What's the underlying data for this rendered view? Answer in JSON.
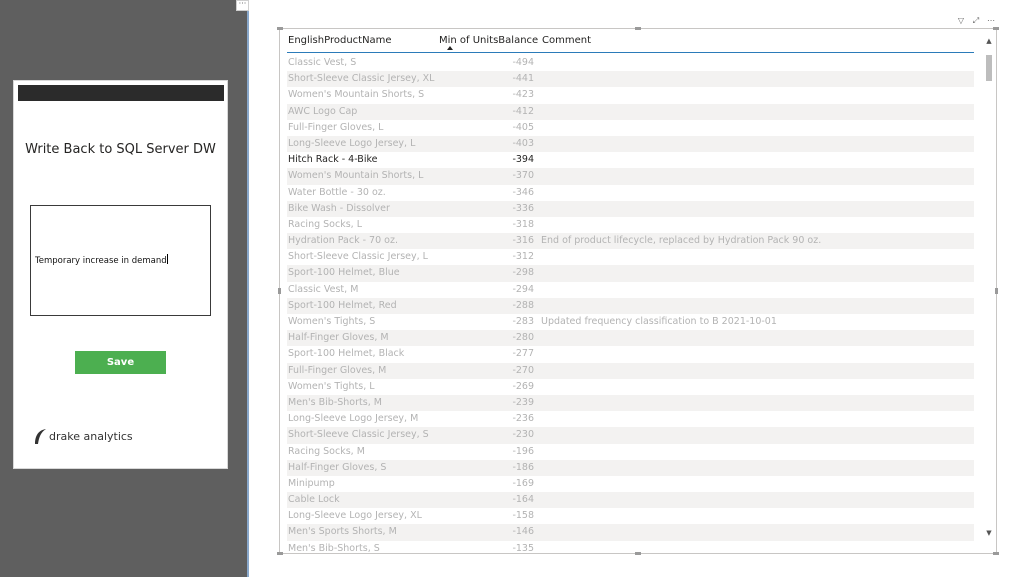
{
  "app": {
    "title": "Write Back to SQL Server DW",
    "comment_value": "Temporary increase in demand",
    "save_label": "Save",
    "logo_text": "drake analytics"
  },
  "more_label": "···",
  "visual_icons": [
    "filter-icon",
    "focus-mode-icon",
    "more-options-icon"
  ],
  "table": {
    "columns": [
      "EnglishProductName",
      "Min of UnitsBalance",
      "Comment"
    ],
    "sorted_column": "Min of UnitsBalance",
    "sort_direction": "ascending",
    "highlighted_row": "Hitch Rack - 4-Bike",
    "rows": [
      {
        "name": "Classic Vest, S",
        "value": "-494",
        "comment": ""
      },
      {
        "name": "Short-Sleeve Classic Jersey, XL",
        "value": "-441",
        "comment": ""
      },
      {
        "name": "Women's Mountain Shorts, S",
        "value": "-423",
        "comment": ""
      },
      {
        "name": "AWC Logo Cap",
        "value": "-412",
        "comment": ""
      },
      {
        "name": "Full-Finger Gloves, L",
        "value": "-405",
        "comment": ""
      },
      {
        "name": "Long-Sleeve Logo Jersey, L",
        "value": "-403",
        "comment": ""
      },
      {
        "name": "Hitch Rack - 4-Bike",
        "value": "-394",
        "comment": ""
      },
      {
        "name": "Women's Mountain Shorts, L",
        "value": "-370",
        "comment": ""
      },
      {
        "name": "Water Bottle - 30 oz.",
        "value": "-346",
        "comment": ""
      },
      {
        "name": "Bike Wash - Dissolver",
        "value": "-336",
        "comment": ""
      },
      {
        "name": "Racing Socks, L",
        "value": "-318",
        "comment": ""
      },
      {
        "name": "Hydration Pack - 70 oz.",
        "value": "-316",
        "comment": "End of product lifecycle, replaced by Hydration Pack 90 oz."
      },
      {
        "name": "Short-Sleeve Classic Jersey, L",
        "value": "-312",
        "comment": ""
      },
      {
        "name": "Sport-100 Helmet, Blue",
        "value": "-298",
        "comment": ""
      },
      {
        "name": "Classic Vest, M",
        "value": "-294",
        "comment": ""
      },
      {
        "name": "Sport-100 Helmet, Red",
        "value": "-288",
        "comment": ""
      },
      {
        "name": "Women's Tights, S",
        "value": "-283",
        "comment": "Updated frequency classification to B 2021-10-01"
      },
      {
        "name": "Half-Finger Gloves, M",
        "value": "-280",
        "comment": ""
      },
      {
        "name": "Sport-100 Helmet, Black",
        "value": "-277",
        "comment": ""
      },
      {
        "name": "Full-Finger Gloves, M",
        "value": "-270",
        "comment": ""
      },
      {
        "name": "Women's Tights, L",
        "value": "-269",
        "comment": ""
      },
      {
        "name": "Men's Bib-Shorts, M",
        "value": "-239",
        "comment": ""
      },
      {
        "name": "Long-Sleeve Logo Jersey, M",
        "value": "-236",
        "comment": ""
      },
      {
        "name": "Short-Sleeve Classic Jersey, S",
        "value": "-230",
        "comment": ""
      },
      {
        "name": "Racing Socks, M",
        "value": "-196",
        "comment": ""
      },
      {
        "name": "Half-Finger Gloves, S",
        "value": "-186",
        "comment": ""
      },
      {
        "name": "Minipump",
        "value": "-169",
        "comment": ""
      },
      {
        "name": "Cable Lock",
        "value": "-164",
        "comment": ""
      },
      {
        "name": "Long-Sleeve Logo Jersey, XL",
        "value": "-158",
        "comment": ""
      },
      {
        "name": "Men's Sports Shorts, M",
        "value": "-146",
        "comment": ""
      },
      {
        "name": "Men's Bib-Shorts, S",
        "value": "-135",
        "comment": ""
      }
    ]
  },
  "colors": {
    "save_button": "#4caf50",
    "header_underline": "#2b7bb9",
    "canvas_left": "#5f5f5f"
  }
}
